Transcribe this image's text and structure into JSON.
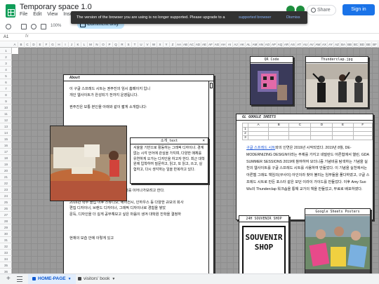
{
  "app": {
    "title": "Temporary space 1.0",
    "menu": [
      "File",
      "Edit",
      "View",
      "Insert"
    ],
    "share_label": "Share",
    "signin_label": "Sign in"
  },
  "banner": {
    "message": "The version of the browser you are using is no longer supported. Please upgrade to a",
    "link": "supported browser",
    "period": ".",
    "dismiss": "Dismiss"
  },
  "toolbar": {
    "zoom": "100%",
    "mode": "Comment only"
  },
  "formula_bar": {
    "cell_ref": "A1",
    "fx": "fx"
  },
  "grid": {
    "columns": [
      "A",
      "B",
      "C",
      "D",
      "E",
      "F",
      "G",
      "H",
      "I",
      "J",
      "K",
      "L",
      "M",
      "N",
      "O",
      "P",
      "Q",
      "R",
      "S",
      "T",
      "U",
      "V",
      "W",
      "X",
      "Y",
      "Z",
      "AA",
      "AB",
      "AC",
      "AD",
      "AE",
      "AF",
      "AG",
      "AH",
      "AI",
      "AJ",
      "AK",
      "AL",
      "AM",
      "AN",
      "AO",
      "AP",
      "AQ",
      "AR",
      "AS",
      "AT",
      "AU",
      "AV",
      "AW",
      "AX",
      "AY",
      "AZ",
      "BA",
      "BB",
      "BC",
      "BD",
      "BE",
      "BF"
    ],
    "rows": [
      "1",
      "2",
      "3",
      "4",
      "5",
      "6",
      "7",
      "8",
      "9",
      "10",
      "11",
      "12",
      "13",
      "14",
      "15",
      "16",
      "17",
      "18",
      "19",
      "20",
      "21",
      "22",
      "23",
      "24",
      "25",
      "26",
      "27",
      "28",
      "29",
      "30",
      "31",
      "32",
      "33",
      "34",
      "35",
      "36",
      "37",
      "38"
    ]
  },
  "about_window": {
    "title": "About",
    "lines": [
      "이 구글 스프레드 시트는 권주진의 임시 홈페이지 입니",
      "개인 웹사이트가 완성되기 전까지 운영됩니다.",
      "",
      "권주진은 보통 본인을 아래와 같이 짧게 소개합니다:",
      "",
      "",
      "",
      "",
      "",
      "",
      "",
      "",
      "",
      "",
      "",
      "",
      "",
      "이 공간을 통해서는 보다 다양하게 소개를 이어나가보려고 한다.",
      "",
      "2016년 학부 졸업 이후 스튜디오, 에이전시, 인하우스 등 다양한 규모의 회사",
      "편집 디자이너, 브랜드 디자이너, 그래픽 디자이너로 경험을 쌓았",
      "문득, 디자인을 더 깊게 공부해보고 싶은 마음이 생겨 대학원 진학을 결정하",
      "",
      "",
      "",
      "현재의 모습 안에 이렇게 있고"
    ]
  },
  "intro_window": {
    "title": "소개_text",
    "text": "서울을 기반으로 활동하는 그래픽 디자이너. 경계 없는 시각 언어에 관심을 가지며, 다양한 매체를 유연하게 오가는 디자인을 하고자 한다. 최근 대학원에 입학하여 질문하고, 읽고, 또 읽고, 쓰고, 실험하고, 다시 생각하는 일을 반복하고 있다."
  },
  "qr_window": {
    "title": "QR Code"
  },
  "thunder_window": {
    "title": "Thunderclap.jpg"
  },
  "gsheets_window": {
    "title": "GL GOOGLE SHEETS",
    "headers": [
      "A",
      "B",
      "C",
      "D",
      "E",
      "F"
    ],
    "rows": [
      "1",
      "2",
      "3"
    ],
    "paragraph_prefix": "구글 스프레드 시트",
    "paragraph": "와의 인연은 2019년 시작되었다. 2019년 8월, DE-MODERNIZING DESIGN이라는 주제를 가지고 네덜란드 아른험에서 열린, GDA SUMMER SESSIONS 2019에 참여하여 모더니즘 기념비를 탐색하는 기념을 실천의 웹사이트를 구글 스프레드 시트를 사용하여 만들었다. 이 기념을 실천에서는 아른헴 그래도 책임의(쿠사이) 아인이라 찾아 불리는 임무들을 풀다하였고, 구글 스프레드 시트로 만든 포스터 같은 모던 이라이 가이드를 만들었다. 이후 Amy Suo Wu의 Thunderclap 워크숍을 통해 교가의 책을 만들었고, 무료로 배포하였다.",
    "link_text": "구글 스프레드 시트"
  },
  "souvenir_window": {
    "title": "24H SOUVENIR SHOP",
    "sign_text": "SOUVENIR SHOP"
  },
  "posters_window": {
    "title": "Google Sheets Posters"
  },
  "tabs": [
    {
      "label": "HOME-PAGE",
      "active": true
    },
    {
      "label": "visitors' book",
      "active": false
    }
  ],
  "colors": {
    "accent": "#1a73e8",
    "sheets_green": "#0f9d58",
    "banner_bg": "#323232",
    "link_blue": "#8ab4f8",
    "grid_bg": "#9a9a9a"
  },
  "icons": [
    "sheets-logo-icon",
    "share-lock-icon",
    "undo-icon",
    "print-icon",
    "paint-format-icon",
    "comment-icon",
    "close-icon",
    "lock-icon",
    "tab-menu-icon",
    "add-sheet-icon"
  ]
}
